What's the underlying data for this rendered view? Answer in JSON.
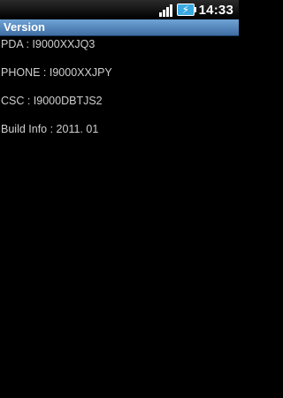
{
  "status_bar": {
    "time": "14:33",
    "icons": [
      "signal-icon",
      "battery-charging-icon"
    ],
    "battery_color": "#39a9e0"
  },
  "title_bar": {
    "title": "Version",
    "color": "#4f81bd"
  },
  "info": {
    "pda": "PDA : I9000XXJQ3",
    "phone": "PHONE : I9000XXJPY",
    "csc": "CSC : I9000DBTJS2",
    "build": "Build Info : 2011. 01"
  }
}
